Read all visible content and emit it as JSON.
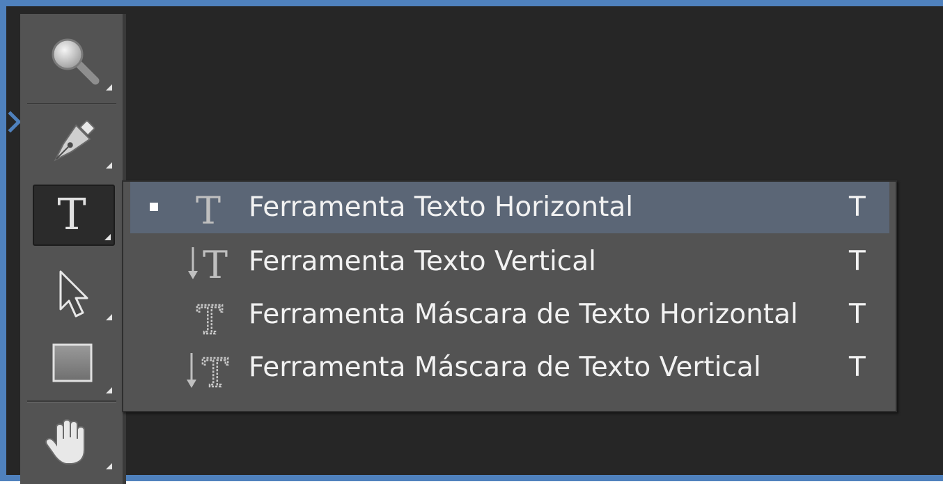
{
  "toolbar": {
    "tools": [
      {
        "name": "zoom-tool",
        "icon": "magnifier-icon"
      },
      {
        "name": "pen-tool",
        "icon": "pen-nib-icon"
      },
      {
        "name": "type-tool",
        "icon": "type-t-icon",
        "active": true
      },
      {
        "name": "path-selection-tool",
        "icon": "arrow-cursor-icon"
      },
      {
        "name": "rectangle-tool",
        "icon": "rectangle-icon"
      },
      {
        "name": "hand-tool",
        "icon": "hand-icon"
      }
    ]
  },
  "flyout": {
    "items": [
      {
        "label": "Ferramenta Texto Horizontal",
        "shortcut": "T",
        "icon": "horizontal-type-icon",
        "selected": true
      },
      {
        "label": "Ferramenta Texto Vertical",
        "shortcut": "T",
        "icon": "vertical-type-icon",
        "selected": false
      },
      {
        "label": "Ferramenta Máscara de Texto Horizontal",
        "shortcut": "T",
        "icon": "horizontal-type-mask-icon",
        "selected": false
      },
      {
        "label": "Ferramenta Máscara de Texto Vertical",
        "shortcut": "T",
        "icon": "vertical-type-mask-icon",
        "selected": false
      }
    ]
  },
  "colors": {
    "frame_border": "#4f81bd",
    "canvas_bg": "#262626",
    "panel_bg": "#535353",
    "selected_item_bg": "#5b6676",
    "text": "#f2f2f2"
  }
}
